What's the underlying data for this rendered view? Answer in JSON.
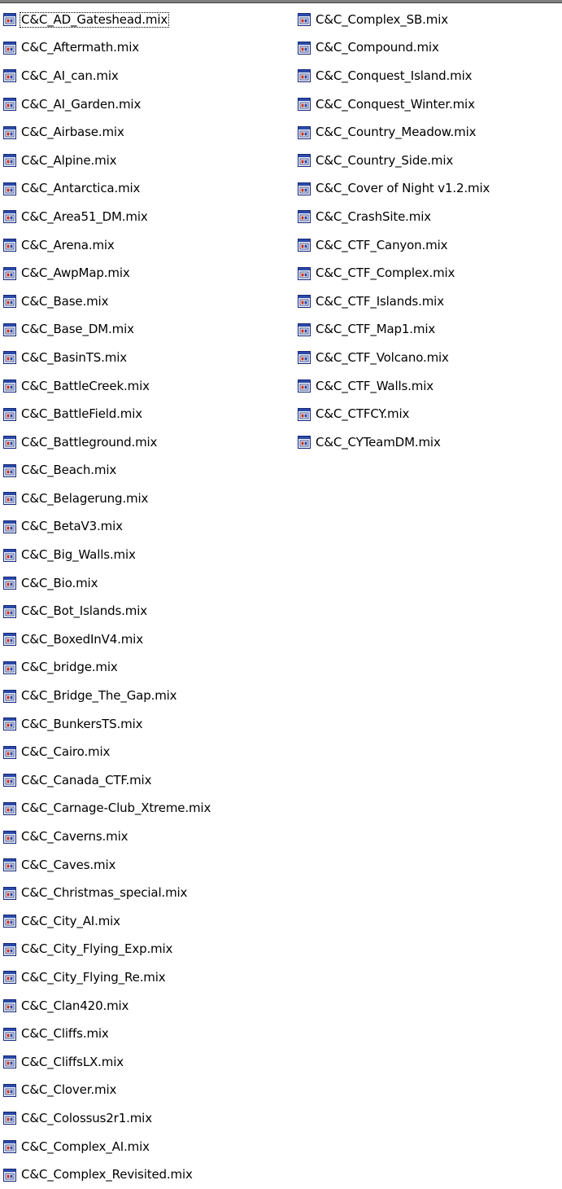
{
  "colors": {
    "icon_border": "#1a2a7a",
    "icon_fill": "#e8eef8",
    "icon_accent": "#c03020",
    "icon_title": "#2a4aa8"
  },
  "file_icon_name": "mix-file-icon",
  "columns": [
    [
      "C&C_AD_Gateshead.mix",
      "C&C_Aftermath.mix",
      "C&C_AI_can.mix",
      "C&C_AI_Garden.mix",
      "C&C_Airbase.mix",
      "C&C_Alpine.mix",
      "C&C_Antarctica.mix",
      "C&C_Area51_DM.mix",
      "C&C_Arena.mix",
      "C&C_AwpMap.mix",
      "C&C_Base.mix",
      "C&C_Base_DM.mix",
      "C&C_BasinTS.mix",
      "C&C_BattleCreek.mix",
      "C&C_BattleField.mix",
      "C&C_Battleground.mix",
      "C&C_Beach.mix",
      "C&C_Belagerung.mix",
      "C&C_BetaV3.mix",
      "C&C_Big_Walls.mix",
      "C&C_Bio.mix",
      "C&C_Bot_Islands.mix",
      "C&C_BoxedInV4.mix",
      "C&C_bridge.mix",
      "C&C_Bridge_The_Gap.mix",
      "C&C_BunkersTS.mix",
      "C&C_Cairo.mix",
      "C&C_Canada_CTF.mix",
      "C&C_Carnage-Club_Xtreme.mix",
      "C&C_Caverns.mix",
      "C&C_Caves.mix",
      "C&C_Christmas_special.mix",
      "C&C_City_AI.mix",
      "C&C_City_Flying_Exp.mix",
      "C&C_City_Flying_Re.mix",
      "C&C_Clan420.mix",
      "C&C_Cliffs.mix",
      "C&C_CliffsLX.mix",
      "C&C_Clover.mix",
      "C&C_Colossus2r1.mix",
      "C&C_Complex_AI.mix",
      "C&C_Complex_Revisited.mix"
    ],
    [
      "C&C_Complex_SB.mix",
      "C&C_Compound.mix",
      "C&C_Conquest_Island.mix",
      "C&C_Conquest_Winter.mix",
      "C&C_Country_Meadow.mix",
      "C&C_Country_Side.mix",
      "C&C_Cover of Night v1.2.mix",
      "C&C_CrashSite.mix",
      "C&C_CTF_Canyon.mix",
      "C&C_CTF_Complex.mix",
      "C&C_CTF_Islands.mix",
      "C&C_CTF_Map1.mix",
      "C&C_CTF_Volcano.mix",
      "C&C_CTF_Walls.mix",
      "C&C_CTFCY.mix",
      "C&C_CYTeamDM.mix"
    ]
  ]
}
